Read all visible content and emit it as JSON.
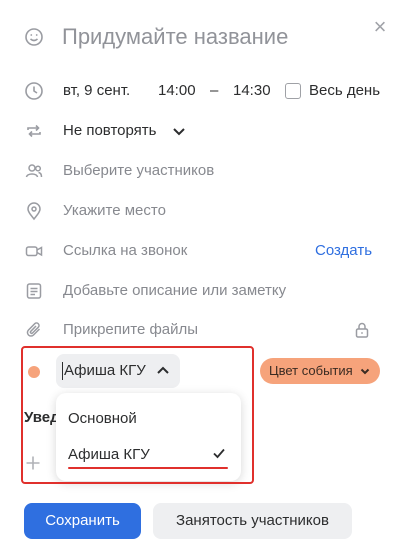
{
  "header": {
    "title_placeholder": "Придумайте название",
    "close_label": "×"
  },
  "datetime": {
    "date": "вт, 9 сент.",
    "start": "14:00",
    "dash": "–",
    "end": "14:30",
    "all_day_label": "Весь день",
    "all_day_checked": false
  },
  "repeat": {
    "value": "Не повторять"
  },
  "participants": {
    "placeholder": "Выберите участников"
  },
  "location": {
    "placeholder": "Укажите место"
  },
  "call": {
    "placeholder": "Ссылка на звонок",
    "create_label": "Создать"
  },
  "description": {
    "placeholder": "Добавьте описание или заметку"
  },
  "attachments": {
    "placeholder": "Прикрепите файлы"
  },
  "calendar": {
    "selected": "Афиша КГУ",
    "dot_color": "#f6a37b",
    "color_button_label": "Цвет события",
    "color_button_bg": "#f6a37b",
    "options": [
      {
        "label": "Основной",
        "selected": false
      },
      {
        "label": "Афиша КГУ",
        "selected": true
      }
    ]
  },
  "notifications": {
    "label_partial": "Увед"
  },
  "footer": {
    "save_label": "Сохранить",
    "busy_label": "Занятость участников"
  },
  "colors": {
    "accent": "#2f6fe0",
    "highlight": "#e0302c"
  }
}
